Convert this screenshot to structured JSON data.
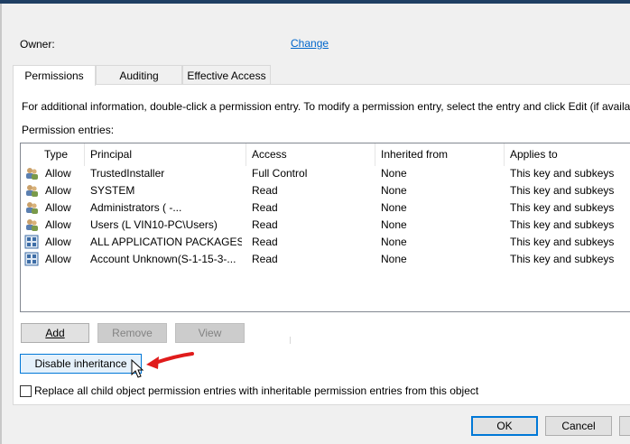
{
  "owner": {
    "label": "Owner:",
    "change_link": "Change"
  },
  "tabs": [
    {
      "label": "Permissions"
    },
    {
      "label": "Auditing"
    },
    {
      "label": "Effective Access"
    }
  ],
  "info_text": "For additional information, double-click a permission entry. To modify a permission entry, select the entry and click Edit (if availa",
  "entries_label": "Permission entries:",
  "columns": {
    "type": "Type",
    "principal": "Principal",
    "access": "Access",
    "inherited": "Inherited from",
    "applies": "Applies to"
  },
  "rows": [
    {
      "icon": "users-icon",
      "type": "Allow",
      "principal": "TrustedInstaller",
      "access": "Full Control",
      "inherited": "None",
      "applies": "This key and subkeys"
    },
    {
      "icon": "users-icon",
      "type": "Allow",
      "principal": "SYSTEM",
      "access": "Read",
      "inherited": "None",
      "applies": "This key and subkeys"
    },
    {
      "icon": "users-icon",
      "type": "Allow",
      "principal": "Administrators (                 -...",
      "access": "Read",
      "inherited": "None",
      "applies": "This key and subkeys"
    },
    {
      "icon": "users-icon",
      "type": "Allow",
      "principal": "Users (L           VIN10-PC\\Users)",
      "access": "Read",
      "inherited": "None",
      "applies": "This key and subkeys"
    },
    {
      "icon": "app-packages-icon",
      "type": "Allow",
      "principal": "ALL APPLICATION PACKAGES",
      "access": "Read",
      "inherited": "None",
      "applies": "This key and subkeys"
    },
    {
      "icon": "app-packages-icon",
      "type": "Allow",
      "principal": "Account Unknown(S-1-15-3-...",
      "access": "Read",
      "inherited": "None",
      "applies": "This key and subkeys"
    }
  ],
  "buttons": {
    "add": "Add",
    "remove": "Remove",
    "view": "View",
    "disable_inheritance": "Disable inheritance",
    "ok": "OK",
    "cancel": "Cancel"
  },
  "checkbox_label": "Replace all child object permission entries with inheritable permission entries from this object",
  "colors": {
    "accent": "#0078d7",
    "link": "#0066cc",
    "arrow": "#e01b1b",
    "titlebar": "#1f3f63"
  }
}
